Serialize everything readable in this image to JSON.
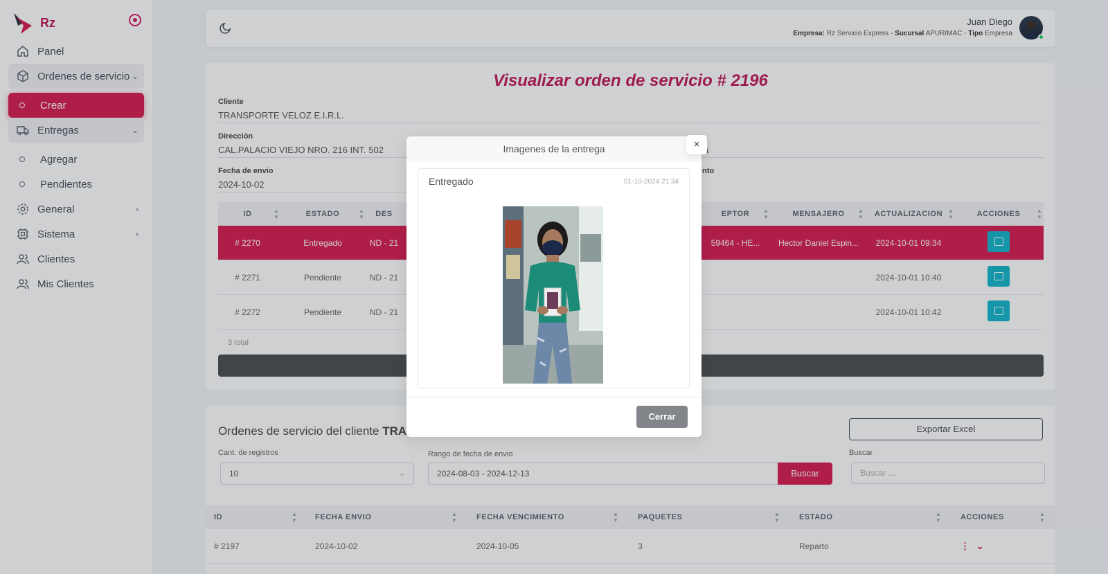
{
  "brand": {
    "name": "Rz"
  },
  "sidebar": {
    "items": [
      {
        "label": "Panel"
      },
      {
        "label": "Ordenes de servicio"
      },
      {
        "label": "Crear"
      },
      {
        "label": "Entregas"
      },
      {
        "label": "Agregar"
      },
      {
        "label": "Pendientes"
      },
      {
        "label": "General"
      },
      {
        "label": "Sistema"
      },
      {
        "label": "Clientes"
      },
      {
        "label": "Mis Clientes"
      }
    ]
  },
  "navbar": {
    "user_name": "Juan Diego",
    "empresa_label": "Empresa:",
    "empresa_value": "Rz Servicio Express",
    "sucursal_label": "Sucursal",
    "sucursal_value": "APURIMAC",
    "tipo_label": "Tipo",
    "tipo_value": "Empresa",
    "sep": "-"
  },
  "order": {
    "title_prefix": "Visualizar orden de servicio",
    "title_number": "# 2196",
    "cliente_label": "Cliente",
    "cliente_value": "TRANSPORTE VELOZ E.I.R.L.",
    "direccion_label": "Dirección",
    "direccion_value": "CAL.PALACIO VIEJO NRO. 216 INT. 502",
    "ubigeo_partial": "ma",
    "fecha_envio_label": "Fecha de envio",
    "fecha_envio_value": "2024-10-02",
    "vencimiento_partial": "iento"
  },
  "deliveries": {
    "columns": {
      "id": "ID",
      "estado": "ESTADO",
      "des": "DES",
      "receptor": "EPTOR",
      "mensajero": "MENSAJERO",
      "actualizacion": "ACTUALIZACION",
      "acciones": "ACCIONES"
    },
    "rows": [
      {
        "id": "# 2270",
        "estado": "Entregado",
        "des": "ND - 21",
        "receptor": "59464 - HE...",
        "mensajero": "Hector Daniel Espin...",
        "actualizacion": "2024-10-01 09:34"
      },
      {
        "id": "# 2271",
        "estado": "Pendiente",
        "des": "ND - 21",
        "receptor": "",
        "mensajero": "",
        "actualizacion": "2024-10-01 10:40"
      },
      {
        "id": "# 2272",
        "estado": "Pendiente",
        "des": "ND - 21",
        "receptor": "",
        "mensajero": "",
        "actualizacion": "2024-10-01 10:42"
      }
    ],
    "total": "3 total"
  },
  "client_orders": {
    "title": "Ordenes de servicio del cliente",
    "title_bold_partial": "TRA",
    "export_label": "Exportar Excel",
    "cant_label": "Cant. de registros",
    "cant_value": "10",
    "rango_label": "Rango de fecha de envio",
    "rango_value": "2024-08-03 - 2024-12-13",
    "buscar_btn": "Buscar",
    "buscar_label": "Buscar",
    "buscar_placeholder": "Buscar ...",
    "columns": {
      "id": "ID",
      "fecha_envio": "FECHA ENVIO",
      "fecha_vencimiento": "FECHA VENCIMIENTO",
      "paquetes": "PAQUETES",
      "estado": "ESTADO",
      "acciones": "ACCIONES"
    },
    "rows": [
      {
        "id": "# 2197",
        "fecha_envio": "2024-10-02",
        "fecha_vencimiento": "2024-10-05",
        "paquetes": "3",
        "estado": "Reparto"
      }
    ]
  },
  "modal": {
    "title": "Imagenes de la entrega",
    "close_symbol": "×",
    "card_title": "Entregado",
    "card_date": "01-10-2024 21:34",
    "cerrar_label": "Cerrar"
  },
  "colors": {
    "accent": "#d81b50",
    "info": "#12b6cc",
    "secondary": "#82868b"
  }
}
